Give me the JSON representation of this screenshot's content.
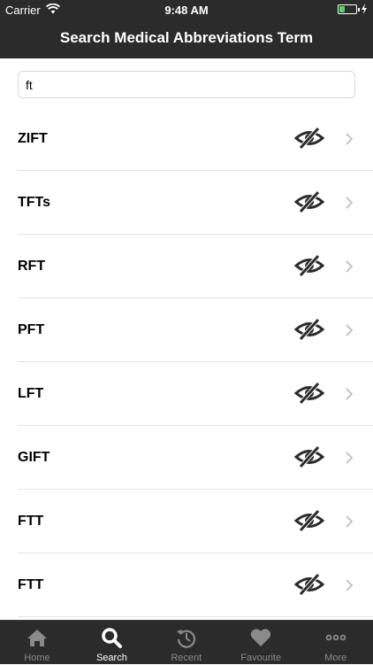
{
  "status_bar": {
    "carrier": "Carrier",
    "time": "9:48 AM",
    "battery_color": "#4cd964"
  },
  "nav": {
    "title": "Search Medical Abbreviations Term"
  },
  "search": {
    "value": "ft",
    "placeholder": ""
  },
  "results": [
    {
      "label": "ZIFT"
    },
    {
      "label": "TFTs"
    },
    {
      "label": "RFT"
    },
    {
      "label": "PFT"
    },
    {
      "label": "LFT"
    },
    {
      "label": "GIFT"
    },
    {
      "label": "FTT"
    },
    {
      "label": "FTT"
    }
  ],
  "tabs": [
    {
      "label": "Home",
      "icon": "home-icon",
      "active": false
    },
    {
      "label": "Search",
      "icon": "search-icon",
      "active": true
    },
    {
      "label": "Recent",
      "icon": "history-icon",
      "active": false
    },
    {
      "label": "Favourite",
      "icon": "heart-icon",
      "active": false
    },
    {
      "label": "More",
      "icon": "more-icon",
      "active": false
    }
  ],
  "colors": {
    "bar_background": "#2b2b2b",
    "tab_inactive": "#8a8a8a",
    "tab_active": "#ffffff"
  }
}
